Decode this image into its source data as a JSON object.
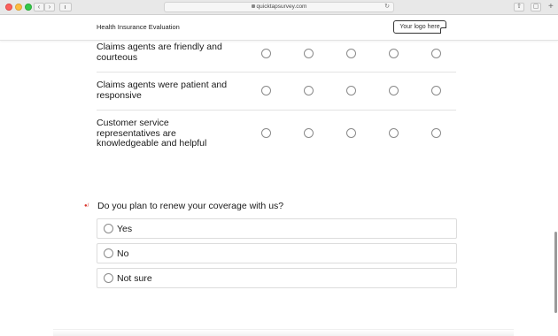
{
  "browser": {
    "url": "quicktapsurvey.com",
    "reload_icon": "↻",
    "back_icon": "‹",
    "forward_icon": "›",
    "share_icon": "⇧",
    "tabs_icon": "▢",
    "new_tab_icon": "+"
  },
  "survey": {
    "title": "Health Insurance Evaluation",
    "logo_text": "Your logo here"
  },
  "matrix": {
    "rows": [
      {
        "label": "Claims agents are friendly and courteous"
      },
      {
        "label": "Claims agents were patient and responsive"
      },
      {
        "label": "Customer service representatives are knowledgeable and helpful"
      }
    ],
    "columns_count": 5
  },
  "question": {
    "text": "Do you plan to renew your coverage with us?",
    "required": true,
    "required_marker": "●/",
    "options": [
      {
        "label": "Yes"
      },
      {
        "label": "No"
      },
      {
        "label": "Not sure"
      }
    ]
  },
  "colors": {
    "required": "#d9342b",
    "radio_border": "#8a8a8a",
    "divider": "#e3e3e3"
  }
}
